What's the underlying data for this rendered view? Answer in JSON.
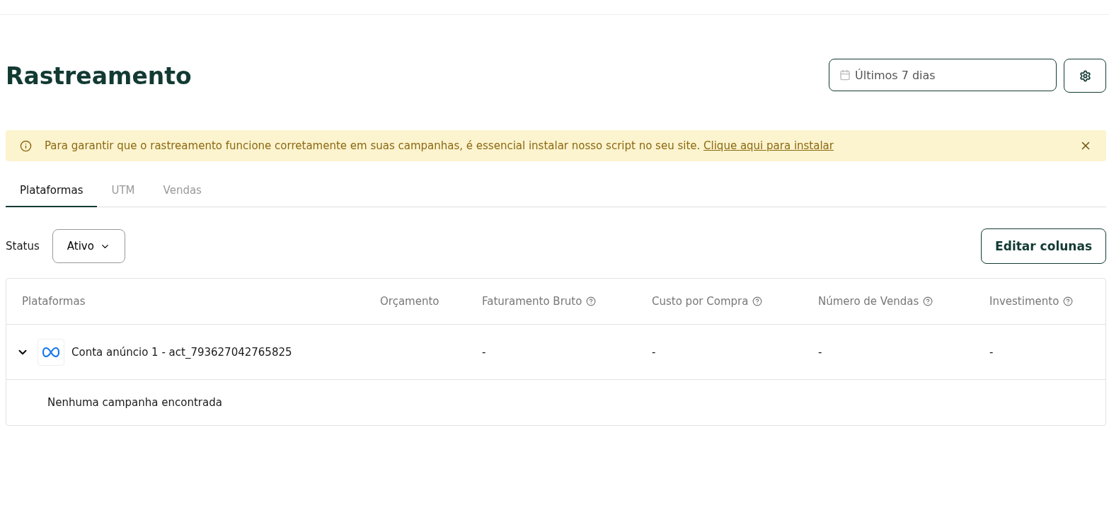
{
  "page_title": "Rastreamento",
  "date_range": {
    "value": "Últimos 7 dias"
  },
  "alert": {
    "message": "Para garantir que o rastreamento funcione corretamente em suas campanhas, é essencial instalar nosso script no seu site.",
    "link": "Clique aqui para instalar"
  },
  "tabs": [
    {
      "label": "Plataformas",
      "selected": true
    },
    {
      "label": "UTM",
      "selected": false
    },
    {
      "label": "Vendas",
      "selected": false
    }
  ],
  "filter": {
    "label": "Status",
    "value": "Ativo"
  },
  "edit_columns_button": "Editar colunas",
  "table": {
    "columns": [
      {
        "label": "Plataformas",
        "help": false
      },
      {
        "label": "Orçamento",
        "help": false
      },
      {
        "label": "Faturamento Bruto",
        "help": true
      },
      {
        "label": "Custo por Compra",
        "help": true
      },
      {
        "label": "Número de Vendas",
        "help": true
      },
      {
        "label": "Investimento",
        "help": true
      }
    ],
    "rows": [
      {
        "expanded": true,
        "cells": [
          "Conta anúncio 1 - act_793627042765825",
          "",
          "-",
          "-",
          "-",
          "-"
        ],
        "empty_message": "Nenhuma campanha encontrada"
      }
    ]
  }
}
